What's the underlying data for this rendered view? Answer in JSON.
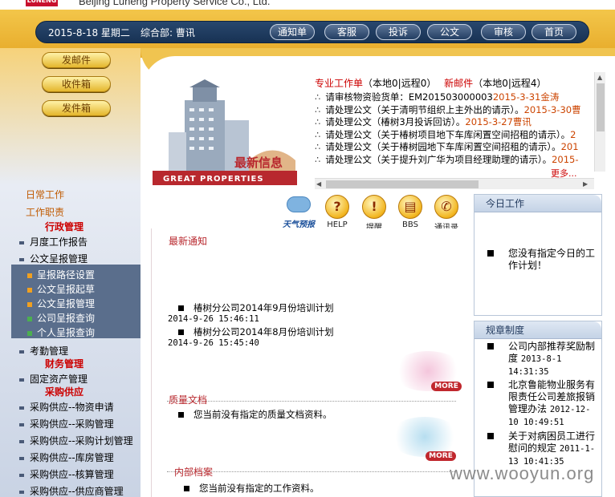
{
  "header": {
    "logo": "LUNENG",
    "company": "Beijing Luneng Property Service Co., Ltd.",
    "date": "2015-8-18 星期二",
    "dept": "综合部: 曹讯",
    "nav": [
      "通知单",
      "客服",
      "投诉",
      "公文",
      "审核",
      "首页"
    ]
  },
  "mail_buttons": [
    "发邮件",
    "收件箱",
    "发件箱"
  ],
  "sidebar": {
    "section1": "日常工作",
    "section2": "工作职责",
    "cat_admin": "行政管理",
    "items_admin": [
      "月度工作报告",
      "公文呈报管理"
    ],
    "sub_items": [
      {
        "label": "呈报路径设置",
        "color": "#f0a020"
      },
      {
        "label": "公文呈报起草",
        "color": "#f0a020"
      },
      {
        "label": "公文呈报管理",
        "color": "#f0a020"
      },
      {
        "label": "公司呈报查询",
        "color": "#4caf50"
      },
      {
        "label": "个人呈报查询",
        "color": "#4caf50"
      }
    ],
    "item_attend": "考勤管理",
    "cat_finance": "财务管理",
    "item_assets": "固定资产管理",
    "cat_purchase": "采购供应",
    "items_purchase": [
      "采购供应--物资申请",
      "采购供应--采购管理",
      "采购供应--采购计划管理",
      "采购供应--库房管理",
      "采购供应--核算管理",
      "采购供应--供应商管理"
    ]
  },
  "banner": {
    "latest_info": "最新信息",
    "great_properties": "GREAT PROPERTIES"
  },
  "info": {
    "tab1": "专业工作单",
    "tab1_counts": "（本地0|远程0）",
    "tab2": "新邮件",
    "tab2_counts": "（本地0|远程4）",
    "rows": [
      {
        "text": "请审核物资验货单：EM201503000003",
        "date": "2015-3-31金涛"
      },
      {
        "text": "请处理公文（关于清明节组织上主外出的请示）。",
        "date": "2015-3-30曹"
      },
      {
        "text": "请处理公文（椿树3月投诉回访）。",
        "date": "2015-3-27曹讯"
      },
      {
        "text": "请处理公文（关于椿树项目地下车库闲置空间招租的请示）。",
        "date": "2"
      },
      {
        "text": "请处理公文（关于椿树园地下车库闲置空间招租的请示）。",
        "date": "201"
      },
      {
        "text": "请处理公文（关于提升刘广华为项目经理助理的请示）。",
        "date": "2015-"
      }
    ],
    "more": "更多..."
  },
  "tools": {
    "weather": "天气预报",
    "help": "HELP",
    "remind": "提醒",
    "bbs": "BBS",
    "contacts": "通讯录"
  },
  "notices": {
    "title": "最新通知",
    "items": [
      {
        "title": "椿树分公司2014年9月份培训计划",
        "time": "2014-9-26 15:46:11"
      },
      {
        "title": "椿树分公司2014年8月份培训计划",
        "time": "2014-9-26 15:45:40"
      }
    ],
    "more": "MORE"
  },
  "quality": {
    "title": "质量文档",
    "empty": "您当前没有指定的质量文档资料。",
    "more": "MORE"
  },
  "internal": {
    "title": "内部档案",
    "empty": "您当前没有指定的工作资料。"
  },
  "today": {
    "title": "今日工作",
    "text": "您没有指定今日的工作计划！"
  },
  "rules": {
    "title": "规章制度",
    "items": [
      {
        "title": "公司内部推荐奖励制度",
        "time": "2013-8-1 14:31:35"
      },
      {
        "title": "北京鲁能物业服务有限责任公司差旅报销管理办法",
        "time": "2012-12-10 10:49:51"
      },
      {
        "title": "关于对病困员工进行慰问的规定",
        "time": "2011-1-13 10:41:35"
      }
    ]
  },
  "watermark": "www.wooyun.org"
}
